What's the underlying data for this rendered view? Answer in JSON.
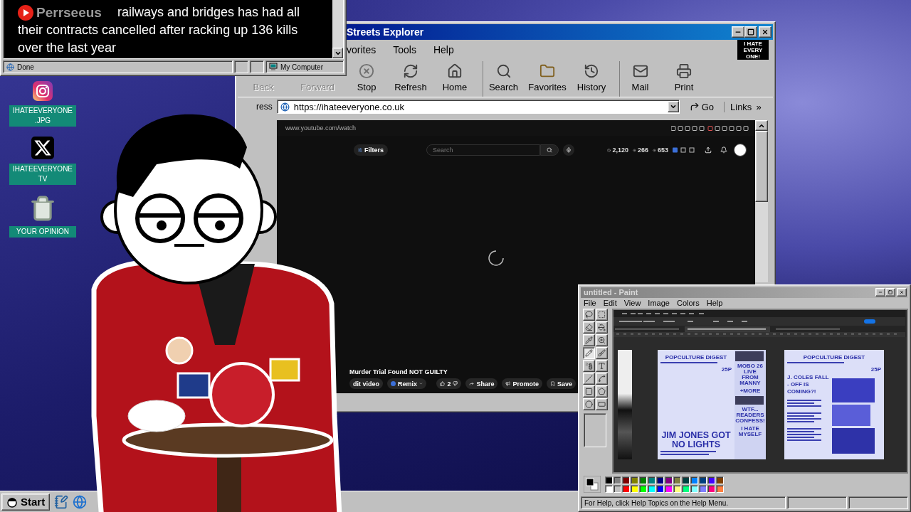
{
  "chat_window": {
    "channel": "Perrseeus",
    "message_lines": [
      "railways and bridges has had all",
      "their contracts cancelled after racking up 136 kills",
      "over the last year"
    ],
    "status": "Done",
    "zone": "My Computer"
  },
  "browser": {
    "title": "Streets Explorer",
    "menu": [
      "vorites",
      "Tools",
      "Help"
    ],
    "logo": [
      "I HATE",
      "EVERY",
      "ONE!"
    ],
    "toolbar": [
      {
        "kind": "back",
        "label": "Back",
        "disabled": true
      },
      {
        "kind": "forward",
        "label": "Forward",
        "disabled": true
      },
      {
        "kind": "stop",
        "label": "Stop",
        "disabled": false
      },
      {
        "kind": "refresh",
        "label": "Refresh",
        "disabled": false
      },
      {
        "kind": "home",
        "label": "Home",
        "disabled": false
      },
      {
        "kind": "search",
        "label": "Search",
        "disabled": false
      },
      {
        "kind": "favorites",
        "label": "Favorites",
        "disabled": false
      },
      {
        "kind": "history",
        "label": "History",
        "disabled": false
      },
      {
        "kind": "mail",
        "label": "Mail",
        "disabled": false
      },
      {
        "kind": "print",
        "label": "Print",
        "disabled": false
      }
    ],
    "address_label": "ress",
    "url": "https://ihateeveryone.co.uk",
    "go": "Go",
    "links": "Links",
    "links_more": "»",
    "page": {
      "url": "www.youtube.com/watch",
      "filters": "Filters",
      "search_placeholder": "Search",
      "stats": [
        {
          "kind": "clock",
          "value": "2,120"
        },
        {
          "kind": "eye",
          "value": "266"
        },
        {
          "kind": "eye",
          "value": "653"
        }
      ],
      "video_title": "Murder Trial Found NOT GUILTY",
      "edit": "dit video",
      "remix": "Remix",
      "likes": "2",
      "actions": [
        {
          "kind": "share",
          "label": "Share"
        },
        {
          "kind": "promote",
          "label": "Promote"
        },
        {
          "kind": "save",
          "label": "Save"
        }
      ]
    }
  },
  "desktop_icons": [
    {
      "kind": "instagram",
      "label": "IHATEEVERYONE .JPG"
    },
    {
      "kind": "x",
      "label": "IHATEEVERYONE TV"
    },
    {
      "kind": "recycle-bin",
      "label": "YOUR OPINION"
    }
  ],
  "paint": {
    "title": "untitled - Paint",
    "menu": [
      "File",
      "Edit",
      "View",
      "Image",
      "Colors",
      "Help"
    ],
    "tools": [
      {
        "kind": "free-select",
        "selected": false
      },
      {
        "kind": "select",
        "selected": false
      },
      {
        "kind": "eraser",
        "selected": false
      },
      {
        "kind": "fill",
        "selected": false
      },
      {
        "kind": "picker",
        "selected": false
      },
      {
        "kind": "magnifier",
        "selected": false
      },
      {
        "kind": "pencil",
        "selected": true
      },
      {
        "kind": "brush",
        "selected": false
      },
      {
        "kind": "airbrush",
        "selected": false
      },
      {
        "kind": "text",
        "selected": false
      },
      {
        "kind": "line",
        "selected": false
      },
      {
        "kind": "curve",
        "selected": false
      },
      {
        "kind": "rectangle",
        "selected": false
      },
      {
        "kind": "polygon",
        "selected": false
      },
      {
        "kind": "ellipse",
        "selected": false
      },
      {
        "kind": "rounded-rectangle",
        "selected": false
      }
    ],
    "posters": [
      {
        "kind": "cover",
        "title": "POPCULTURE DIGEST",
        "price": "25P",
        "headline": "JIM JONES GOT NO LIGHTS",
        "sidebar": [
          "MOBO 26 LIVE FROM MANNY",
          "+MORE",
          "WTF... READERS CONFESS!",
          "I HATE MYSELF"
        ]
      },
      {
        "kind": "feature",
        "title": "POPCULTURE DIGEST",
        "price": "25P",
        "headline": "J. COLES FALL - OFF IS COMING?!"
      }
    ],
    "palette": [
      {
        "color": "#000000"
      },
      {
        "color": "#808080"
      },
      {
        "color": "#800000"
      },
      {
        "color": "#808000"
      },
      {
        "color": "#008000"
      },
      {
        "color": "#008080"
      },
      {
        "color": "#000080"
      },
      {
        "color": "#800080"
      },
      {
        "color": "#808040"
      },
      {
        "color": "#004040"
      },
      {
        "color": "#0080ff"
      },
      {
        "color": "#004080"
      },
      {
        "color": "#4000ff"
      },
      {
        "color": "#804000"
      },
      {
        "color": "#ffffff"
      },
      {
        "color": "#c0c0c0"
      },
      {
        "color": "#ff0000"
      },
      {
        "color": "#ffff00"
      },
      {
        "color": "#00ff00"
      },
      {
        "color": "#00ffff"
      },
      {
        "color": "#0000ff"
      },
      {
        "color": "#ff00ff"
      },
      {
        "color": "#ffff80"
      },
      {
        "color": "#00ff80"
      },
      {
        "color": "#80ffff"
      },
      {
        "color": "#8080ff"
      },
      {
        "color": "#ff0080"
      },
      {
        "color": "#ff8040"
      }
    ],
    "status": "For Help, click Help Topics on the Help Menu."
  },
  "taskbar": {
    "start": "Start"
  }
}
